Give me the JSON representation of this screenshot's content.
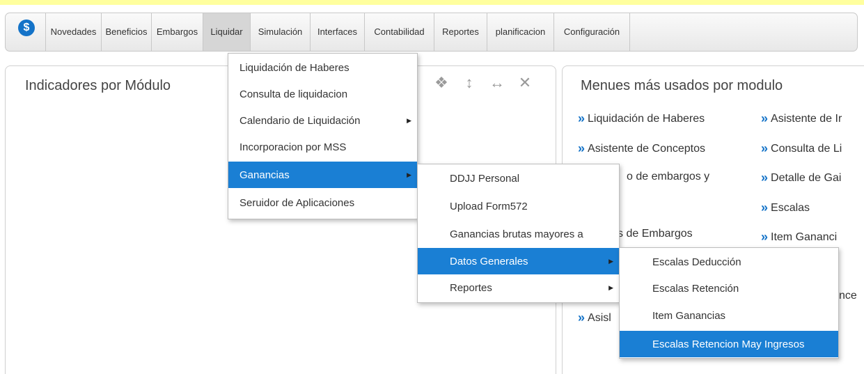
{
  "menubar": {
    "logo": "$",
    "items": [
      {
        "label": "Novedades"
      },
      {
        "label": "Beneficios"
      },
      {
        "label": "Embargos"
      },
      {
        "label": "Liquidar"
      },
      {
        "label": "Simulación"
      },
      {
        "label": "Interfaces"
      },
      {
        "label": "Contabilidad"
      },
      {
        "label": "Reportes"
      },
      {
        "label": "planificacion"
      },
      {
        "label": "Configuración"
      }
    ],
    "active": "Liquidar"
  },
  "left_panel": {
    "title": "Indicadores por Módulo",
    "tools": {
      "move": "❖",
      "resize_v": "↕",
      "resize_h": "↔",
      "close": "✕"
    }
  },
  "right_panel": {
    "title": "Menues más usados por modulo",
    "chevron": "»",
    "col1": [
      "Liquidación de Haberes",
      "Asistente de Conceptos",
      "o de embargos y",
      "s de Embargos",
      "Asisl"
    ],
    "col2": [
      "Asistente de Ir",
      "Consulta de Li",
      "Detalle de Gai",
      "Escalas",
      "Item Gananci",
      "nce"
    ]
  },
  "liquidar_menu": {
    "items": [
      {
        "label": "Liquidación de Haberes"
      },
      {
        "label": "Consulta de liquidacion"
      },
      {
        "label": "Calendario de Liquidación",
        "arrow": "▶"
      },
      {
        "label": "Incorporacion por MSS"
      },
      {
        "label": "Ganancias",
        "arrow": "▶"
      },
      {
        "label": "Seruidor de Aplicaciones"
      }
    ],
    "selected": "Ganancias"
  },
  "ganancias_menu": {
    "items": [
      {
        "label": "DDJJ Personal"
      },
      {
        "label": "Upload Form572"
      },
      {
        "label": "Ganancias brutas mayores a"
      },
      {
        "label": "Datos Generales",
        "arrow": "▶"
      },
      {
        "label": "Reportes",
        "arrow": "▶"
      }
    ],
    "selected": "Datos Generales"
  },
  "datos_generales_menu": {
    "items": [
      {
        "label": "Escalas Deducción"
      },
      {
        "label": "Escalas Retención"
      },
      {
        "label": "Item Ganancias"
      },
      {
        "label": "Escalas Retencion May Ingresos"
      }
    ],
    "selected": "Escalas Retencion May Ingresos"
  },
  "colors": {
    "accent": "#1a7fd4",
    "stripe": "#ffff9e"
  }
}
